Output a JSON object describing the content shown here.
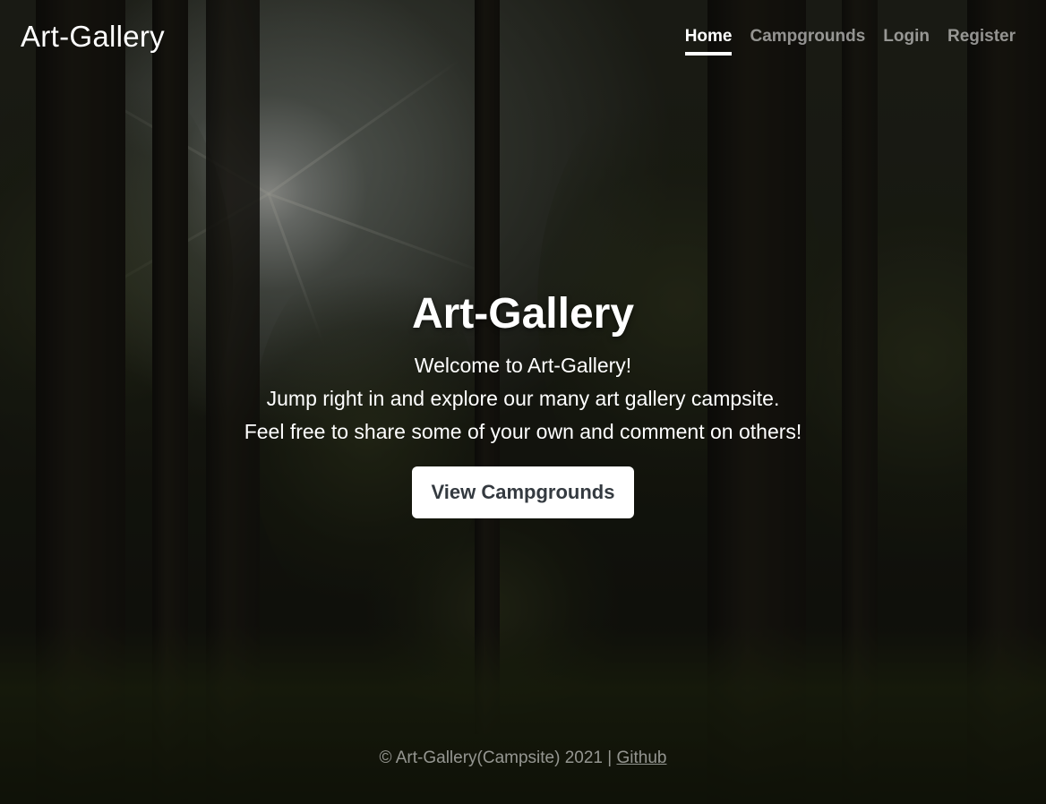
{
  "header": {
    "brand": "Art-Gallery",
    "nav": [
      {
        "label": "Home",
        "active": true
      },
      {
        "label": "Campgrounds",
        "active": false
      },
      {
        "label": "Login",
        "active": false
      },
      {
        "label": "Register",
        "active": false
      }
    ]
  },
  "hero": {
    "title": "Art-Gallery",
    "lines": [
      "Welcome to Art-Gallery!",
      "Jump right in and explore our many art gallery campsite.",
      "Feel free to share some of your own and comment on others!"
    ],
    "cta_label": "View Campgrounds"
  },
  "footer": {
    "text": "© Art-Gallery(Campsite) 2021 | ",
    "link_label": "Github"
  },
  "colors": {
    "button_text": "#343a40",
    "active_nav": "#ffffff",
    "muted_nav": "rgba(255,255,255,0.55)"
  }
}
